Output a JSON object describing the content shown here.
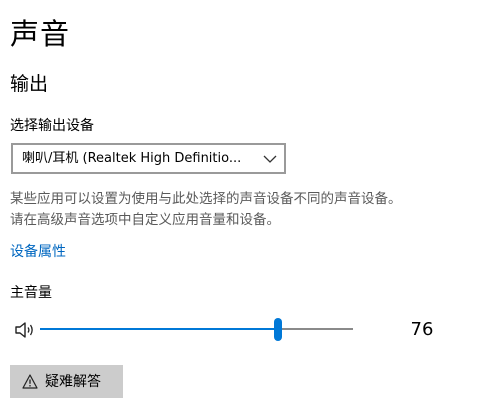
{
  "page": {
    "title": "声音"
  },
  "output": {
    "section_title": "输出",
    "device_label": "选择输出设备",
    "device_value": "喇叭/耳机 (Realtek High Definitio...",
    "description_line1": "某些应用可以设置为使用与此处选择的声音设备不同的声音设备。",
    "description_line2": "请在高级声音选项中自定义应用音量和设备。",
    "device_properties_link": "设备属性",
    "master_volume_label": "主音量",
    "master_volume_value": "76",
    "master_volume_level": 76,
    "troubleshoot_label": "疑难解答"
  },
  "icons": {
    "speaker": "speaker-volume-icon",
    "dropdown": "chevron-down-icon",
    "warning": "warning-icon"
  },
  "colors": {
    "accent": "#0078d7",
    "link": "#0067c0",
    "button_bg": "#cccccc",
    "secondary_text": "#5a5a5a"
  }
}
